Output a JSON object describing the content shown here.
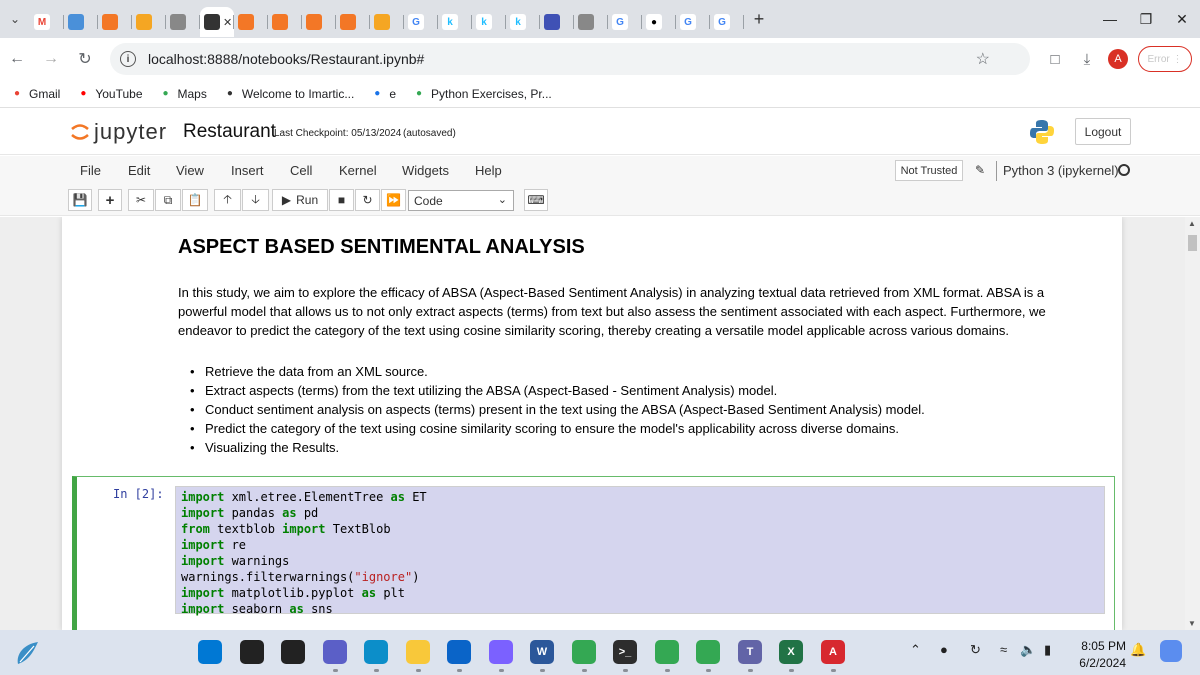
{
  "browser": {
    "tabs": [
      {
        "icon": "gmail-icon",
        "color": "#ea4335",
        "glyph": "M",
        "active": false
      },
      {
        "icon": "site-icon-1",
        "color": "#4a90d9",
        "glyph": "",
        "active": false
      },
      {
        "icon": "jupyter-tab-icon",
        "color": "#f37726",
        "glyph": "",
        "active": false
      },
      {
        "icon": "book-icon",
        "color": "#f5a623",
        "glyph": "",
        "active": false
      },
      {
        "icon": "globe-icon",
        "color": "#888888",
        "glyph": "",
        "active": false
      },
      {
        "icon": "x-icon",
        "color": "#333333",
        "glyph": "",
        "active": true
      },
      {
        "icon": "jupyter-tab-icon",
        "color": "#f37726",
        "glyph": "",
        "active": false
      },
      {
        "icon": "jupyter-tab-icon",
        "color": "#f37726",
        "glyph": "",
        "active": false
      },
      {
        "icon": "jupyter-tab-icon",
        "color": "#f37726",
        "glyph": "",
        "active": false
      },
      {
        "icon": "jupyter-tab-icon",
        "color": "#f37726",
        "glyph": "",
        "active": false
      },
      {
        "icon": "book-icon",
        "color": "#f5a623",
        "glyph": "",
        "active": false
      },
      {
        "icon": "google-icon",
        "color": "#4285f4",
        "glyph": "G",
        "active": false
      },
      {
        "icon": "kaggle-icon",
        "color": "#20beff",
        "glyph": "k",
        "active": false
      },
      {
        "icon": "kaggle-icon",
        "color": "#20beff",
        "glyph": "k",
        "active": false
      },
      {
        "icon": "kaggle-icon",
        "color": "#20beff",
        "glyph": "k",
        "active": false
      },
      {
        "icon": "printer-icon",
        "color": "#3f51b5",
        "glyph": "",
        "active": false
      },
      {
        "icon": "globe-icon",
        "color": "#888888",
        "glyph": "",
        "active": false
      },
      {
        "icon": "google-icon",
        "color": "#4285f4",
        "glyph": "G",
        "active": false
      },
      {
        "icon": "medium-icon",
        "color": "#000000",
        "glyph": "●",
        "active": false
      },
      {
        "icon": "google-icon",
        "color": "#4285f4",
        "glyph": "G",
        "active": false
      },
      {
        "icon": "google-icon",
        "color": "#4285f4",
        "glyph": "G",
        "active": false
      }
    ],
    "url": "localhost:8888/notebooks/Restaurant.ipynb#",
    "avatar_letter": "A",
    "error_label": "Error",
    "bookmarks": [
      {
        "label": "Gmail",
        "icon": "gmail-icon"
      },
      {
        "label": "YouTube",
        "icon": "youtube-icon"
      },
      {
        "label": "Maps",
        "icon": "maps-icon"
      },
      {
        "label": "Welcome to Imartic...",
        "icon": "globe-icon"
      },
      {
        "label": "e",
        "icon": "circle-icon"
      },
      {
        "label": "Python Exercises, Pr...",
        "icon": "link-icon"
      }
    ]
  },
  "jupyter": {
    "logo_text": "jupyter",
    "notebook_name": "Restaurant",
    "checkpoint": "Last Checkpoint: 05/13/2024",
    "autosaved": "(autosaved)",
    "logout": "Logout",
    "menus": [
      "File",
      "Edit",
      "View",
      "Insert",
      "Cell",
      "Kernel",
      "Widgets",
      "Help"
    ],
    "trust": "Not Trusted",
    "kernel": "Python 3 (ipykernel)",
    "run_label": "Run",
    "cell_type": "Code"
  },
  "notebook": {
    "heading": "ASPECT BASED SENTIMENTAL ANALYSIS",
    "paragraph": "In this study, we aim to explore the efficacy of ABSA (Aspect-Based Sentiment Analysis) in analyzing textual data retrieved from XML format. ABSA is a powerful model that allows us to not only extract aspects (terms) from text but also assess the sentiment associated with each aspect. Furthermore, we endeavor to predict the category of the text using cosine similarity scoring, thereby creating a versatile model applicable across various domains.",
    "bullets": [
      "Retrieve the data from an XML source.",
      "Extract aspects (terms) from the text utilizing the ABSA (Aspect-Based - Sentiment Analysis) model.",
      "Conduct sentiment analysis on aspects (terms) present in the text using the ABSA (Aspect-Based Sentiment Analysis) model.",
      "Predict the category of the text using cosine similarity scoring to ensure the model's applicability across diverse domains.",
      "Visualizing the Results."
    ],
    "prompt": "In [2]:",
    "code_lines": [
      [
        {
          "t": "import",
          "k": "kw"
        },
        {
          "t": " xml.etree.ElementTree ",
          "k": ""
        },
        {
          "t": "as",
          "k": "kw"
        },
        {
          "t": " ET",
          "k": ""
        }
      ],
      [
        {
          "t": "import",
          "k": "kw"
        },
        {
          "t": " pandas ",
          "k": ""
        },
        {
          "t": "as",
          "k": "kw"
        },
        {
          "t": " pd",
          "k": ""
        }
      ],
      [
        {
          "t": "from",
          "k": "kw"
        },
        {
          "t": " textblob ",
          "k": ""
        },
        {
          "t": "import",
          "k": "kw"
        },
        {
          "t": " TextBlob",
          "k": ""
        }
      ],
      [
        {
          "t": "import",
          "k": "kw"
        },
        {
          "t": " re",
          "k": ""
        }
      ],
      [
        {
          "t": "import",
          "k": "kw"
        },
        {
          "t": " warnings",
          "k": ""
        }
      ],
      [
        {
          "t": "warnings.filterwarnings(",
          "k": ""
        },
        {
          "t": "\"ignore\"",
          "k": "str"
        },
        {
          "t": ")",
          "k": ""
        }
      ],
      [
        {
          "t": "import",
          "k": "kw"
        },
        {
          "t": " matplotlib.pyplot ",
          "k": ""
        },
        {
          "t": "as",
          "k": "kw"
        },
        {
          "t": " plt",
          "k": ""
        }
      ],
      [
        {
          "t": "import",
          "k": "kw"
        },
        {
          "t": " seaborn ",
          "k": ""
        },
        {
          "t": "as",
          "k": "kw"
        },
        {
          "t": " sns",
          "k": ""
        }
      ]
    ]
  },
  "taskbar": {
    "apps": [
      {
        "icon": "windows-start-icon",
        "color": "#0078d4"
      },
      {
        "icon": "search-icon",
        "color": "#222222"
      },
      {
        "icon": "task-view-icon",
        "color": "#222222"
      },
      {
        "icon": "meet-icon",
        "color": "#5b5fc7"
      },
      {
        "icon": "edge-icon",
        "color": "#0c8ec9"
      },
      {
        "icon": "file-explorer-icon",
        "color": "#f8c83a"
      },
      {
        "icon": "mail-icon",
        "color": "#0a64c8"
      },
      {
        "icon": "copilot-icon",
        "color": "#7b61ff"
      },
      {
        "icon": "word-icon",
        "color": "#2b579a"
      },
      {
        "icon": "chrome-icon",
        "color": "#34a853"
      },
      {
        "icon": "terminal-icon",
        "color": "#2d2d2d"
      },
      {
        "icon": "chrome-icon",
        "color": "#34a853"
      },
      {
        "icon": "chrome-icon",
        "color": "#34a853"
      },
      {
        "icon": "teams-icon",
        "color": "#6264a7"
      },
      {
        "icon": "excel-icon",
        "color": "#217346"
      },
      {
        "icon": "acrobat-icon",
        "color": "#d7282f"
      }
    ],
    "app_glyphs": [
      "",
      "",
      "",
      "",
      "",
      "",
      "",
      "",
      "W",
      "",
      ">_",
      "",
      "",
      "T",
      "X",
      "A"
    ],
    "time": "8:05 PM",
    "date": "6/2/2024"
  }
}
